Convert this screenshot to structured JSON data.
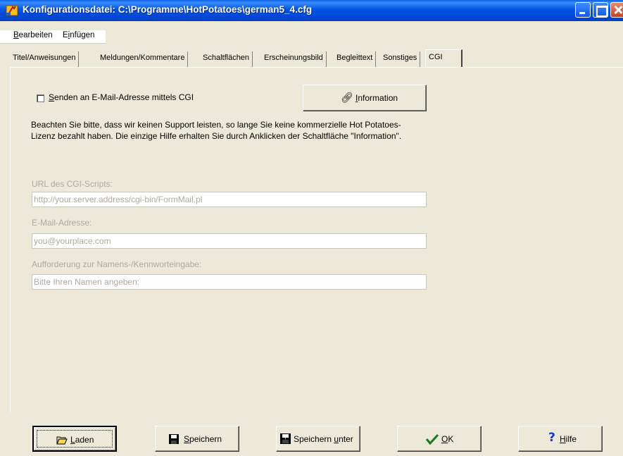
{
  "window": {
    "title": "Konfigurationsdatei: C:\\Programme\\HotPotatoes\\german5_4.cfg"
  },
  "menu": {
    "items": [
      {
        "label": "Bearbeiten",
        "mnemonic": "B"
      },
      {
        "label": "Einfügen",
        "mnemonic": "i"
      }
    ]
  },
  "tabs": [
    {
      "label": "Titel/Anweisungen",
      "active": false
    },
    {
      "label": "Meldungen/Kommentare",
      "active": false
    },
    {
      "label": "Schaltflächen",
      "active": false
    },
    {
      "label": "Erscheinungsbild",
      "active": false
    },
    {
      "label": "Begleittext",
      "active": false
    },
    {
      "label": "Sonstiges",
      "active": false
    },
    {
      "label": "CGI",
      "active": true
    }
  ],
  "cgi": {
    "checkbox_label": "Senden an E-Mail-Adresse mittels CGI",
    "checkbox_checked": false,
    "info_button_label": "Information",
    "notice": "Beachten Sie bitte, dass wir keinen Support leisten, so lange Sie keine kommerzielle Hot Potatoes-Lizenz bezahlt haben. Die einzige Hilfe erhalten Sie durch Anklicken der Schaltfläche \"Information\".",
    "url_label": "URL des CGI-Scripts:",
    "url_value": "http://your.server.address/cgi-bin/FormMail.pl",
    "email_label": "E-Mail-Adresse:",
    "email_value": "you@yourplace.com",
    "prompt_label": "Aufforderung zur Namens-/Kennworteingabe:",
    "prompt_value": "Bitte Ihren Namen angeben:"
  },
  "buttons": {
    "laden": "Laden",
    "speichern": "Speichern",
    "speichern_unter": "Speichern unter",
    "ok": "OK",
    "hilfe": "Hilfe"
  },
  "icons": {
    "app": "hotpotatoes-config-icon",
    "info": "chain-link-icon",
    "laden": "open-folder-icon",
    "speichern": "floppy-disk-icon",
    "speichern_unter": "floppy-disk-save-as-icon",
    "ok": "checkmark-icon",
    "hilfe": "question-mark-icon"
  },
  "colors": {
    "titlebar": "#0052e0",
    "window_bg": "#ece9d8",
    "disabled_text": "#adaa9c",
    "ok_check": "#1a7a1a",
    "help_mark": "#1636c8"
  }
}
